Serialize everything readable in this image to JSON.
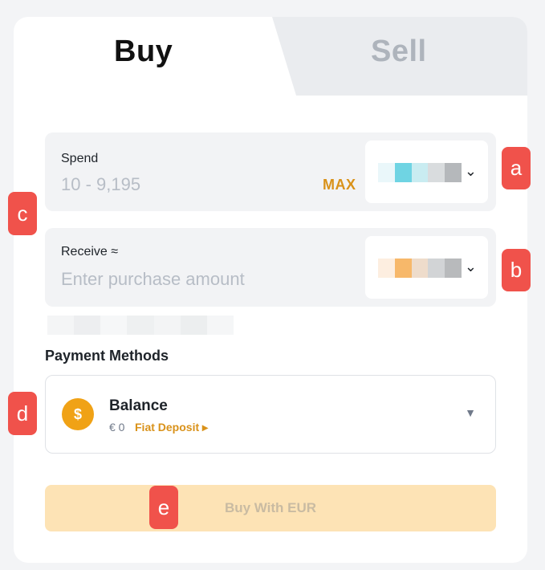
{
  "tabs": {
    "buy": "Buy",
    "sell": "Sell"
  },
  "spend": {
    "label": "Spend",
    "range": "10 - 9,195",
    "max": "MAX"
  },
  "receive": {
    "label": "Receive ≈",
    "placeholder": "Enter purchase amount"
  },
  "payment": {
    "title": "Payment Methods",
    "method": "Balance",
    "amount": "€ 0",
    "link": "Fiat Deposit ▸"
  },
  "button": {
    "label": "Buy With EUR"
  },
  "badges": {
    "a": "a",
    "b": "b",
    "c": "c",
    "d": "d",
    "e": "e"
  },
  "colors": {
    "accent": "#f0a216",
    "badge": "#f0524b",
    "button_bg": "#fde3b5"
  },
  "icons": {
    "selector_arrow": "chevron-down-icon",
    "coin": "coin-icon",
    "method_caret": "caret-down-icon"
  }
}
